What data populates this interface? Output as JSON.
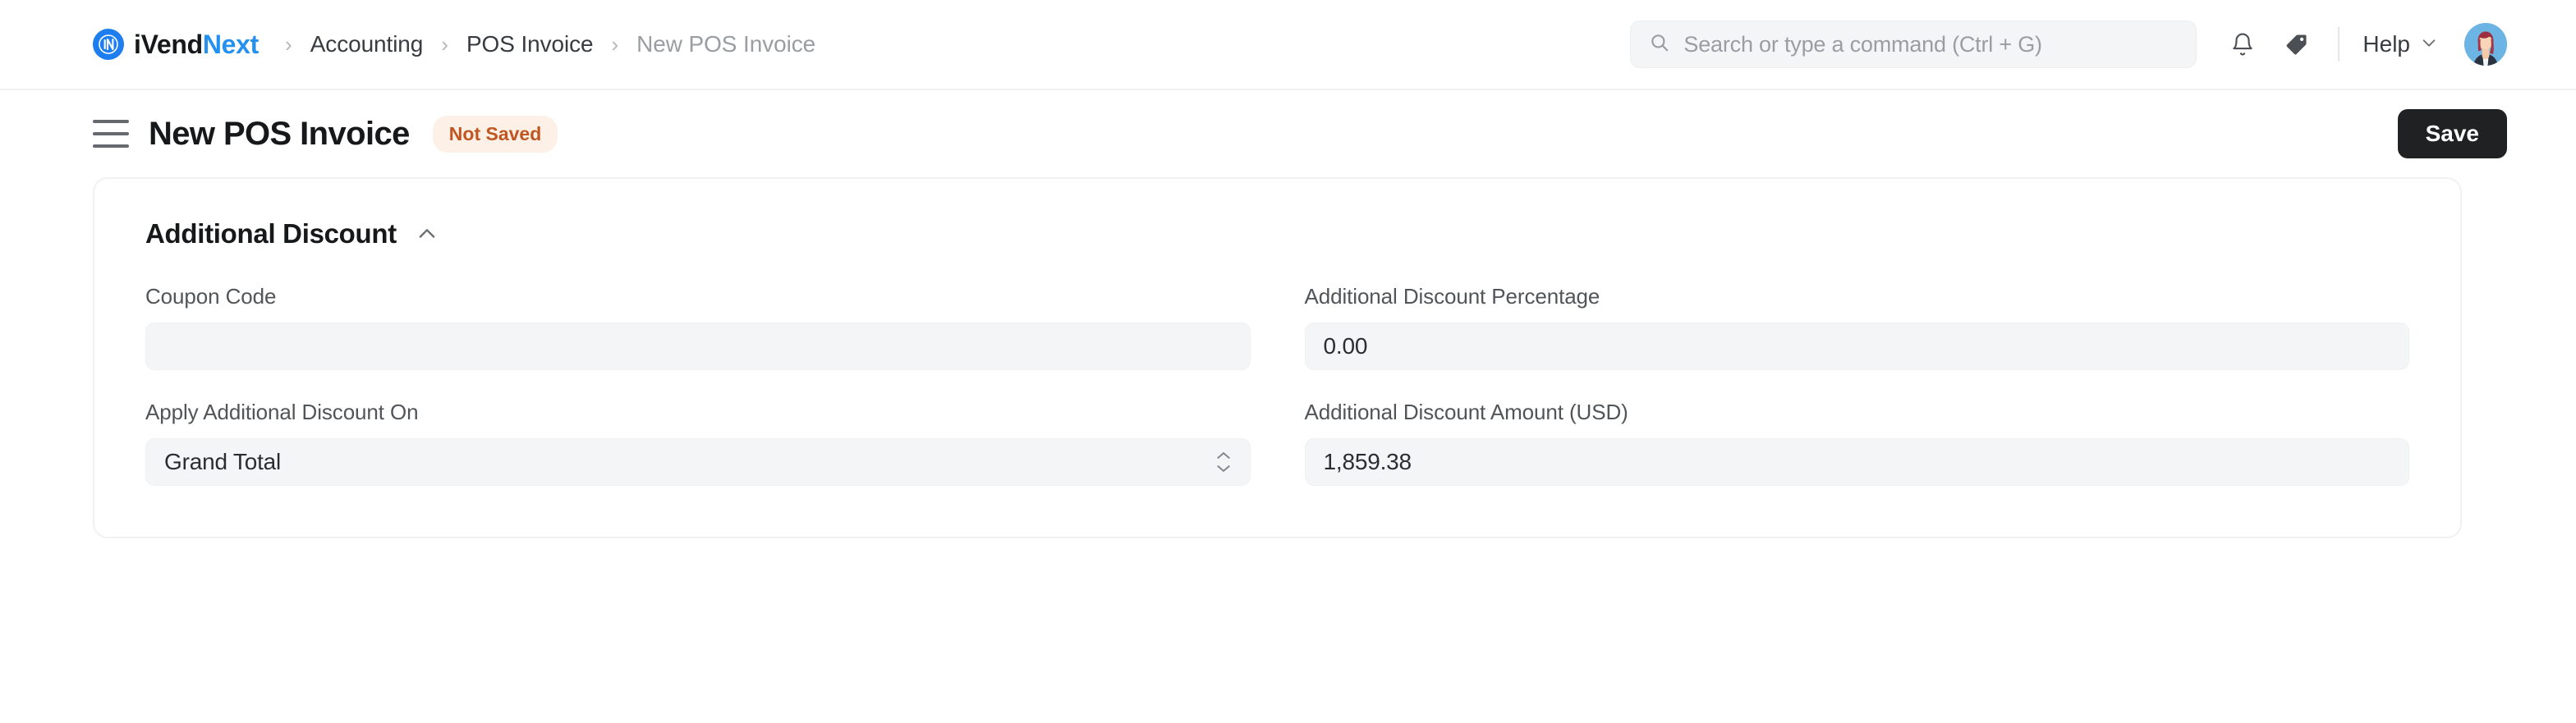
{
  "navbar": {
    "brand": {
      "name_dark": "iVend",
      "name_blue": "Next",
      "logo_icon": "ivendnext-logo-icon"
    },
    "breadcrumbs": [
      {
        "label": "Accounting",
        "muted": false
      },
      {
        "label": "POS Invoice",
        "muted": false
      },
      {
        "label": "New POS Invoice",
        "muted": true
      }
    ],
    "separator": "›",
    "search": {
      "placeholder": "Search or type a command (Ctrl + G)",
      "value": "",
      "icon": "search-icon"
    },
    "notifications_icon": "bell-icon",
    "tag_icon": "tag-icon",
    "help": {
      "label": "Help",
      "chevron": "chevron-down-icon"
    },
    "avatar_icon": "user-avatar"
  },
  "page": {
    "menu_icon": "hamburger-menu-icon",
    "title": "New POS Invoice",
    "status_badge": "Not Saved",
    "save_label": "Save"
  },
  "section": {
    "title": "Additional Discount",
    "collapse_icon": "chevron-up-icon",
    "fields": [
      {
        "label": "Coupon Code",
        "value": "",
        "type": "text"
      },
      {
        "label": "Additional Discount Percentage",
        "value": "0.00",
        "type": "text"
      },
      {
        "label": "Apply Additional Discount On",
        "value": "Grand Total",
        "type": "select"
      },
      {
        "label": "Additional Discount Amount (USD)",
        "value": "1,859.38",
        "type": "text"
      }
    ]
  },
  "colors": {
    "brand_blue": "#2490ef",
    "badge_bg": "#fdf0e6",
    "badge_text": "#c05621",
    "save_bg": "#1f2123",
    "input_bg": "#f4f5f6",
    "border": "#f1f1f2"
  }
}
